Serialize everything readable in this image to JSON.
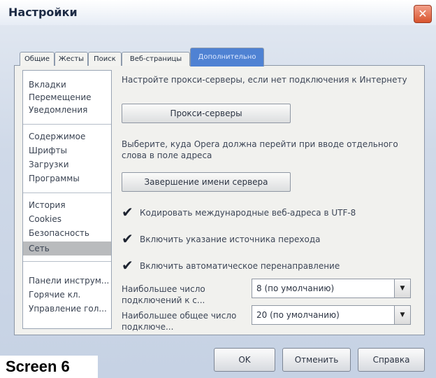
{
  "window": {
    "title": "Настройки",
    "close_glyph": "✕"
  },
  "tabs": [
    {
      "label": "Общие",
      "active": false
    },
    {
      "label": "Жесты",
      "active": false
    },
    {
      "label": "Поиск",
      "active": false
    },
    {
      "label": "Веб-страницы",
      "active": false
    },
    {
      "label": "Дополнительно",
      "active": true
    }
  ],
  "sidebar": {
    "groups": [
      {
        "items": [
          "Вкладки",
          "Перемещение",
          "Уведомления"
        ]
      },
      {
        "items": [
          "Содержимое",
          "Шрифты",
          "Загрузки",
          "Программы"
        ]
      },
      {
        "items": [
          "История",
          "Cookies",
          "Безопасность",
          "Сеть"
        ]
      },
      {
        "items": [
          "Панели инструм...",
          "Горячие кл.",
          "Управление гол..."
        ]
      }
    ],
    "selected": "Сеть"
  },
  "main": {
    "proxy_text": "Настройте прокси-серверы, если нет подключения к Интернету",
    "proxy_button": "Прокси-серверы",
    "server_text_1": "Выберите, куда Opera должна перейти при вводе отдельного",
    "server_text_2": "слова в поле адреса",
    "server_button": "Завершение имени сервера",
    "checkboxes": [
      {
        "label": "Кодировать международные веб-адреса в UTF-8",
        "checked": true
      },
      {
        "label": "Включить указание источника перехода",
        "checked": true
      },
      {
        "label": "Включить автоматическое перенаправление",
        "checked": true
      }
    ],
    "max_conn_server_label": "Наибольшее число подключений к с...",
    "max_conn_server_value": "8 (по умолчанию)",
    "max_conn_total_label": "Наибольшее общее число подключе...",
    "max_conn_total_value": "20 (по умолчанию)"
  },
  "footer": {
    "ok": "OK",
    "cancel": "Отменить",
    "help": "Справка"
  },
  "caption": "Screen 6",
  "icons": {
    "check": "check-icon",
    "dropdown": "dropdown-arrow-icon",
    "close": "close-icon"
  }
}
